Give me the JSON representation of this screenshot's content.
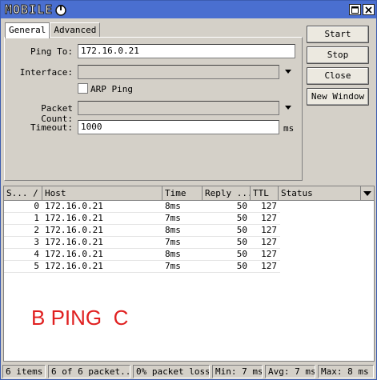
{
  "window": {
    "logo_text": "MOBILE",
    "maximize_icon": "maximize-icon",
    "close_icon": "close-icon"
  },
  "tabs": [
    {
      "label": "General",
      "active": true
    },
    {
      "label": "Advanced",
      "active": false
    }
  ],
  "form": {
    "ping_to_label": "Ping To:",
    "ping_to_value": "172.16.0.21",
    "interface_label": "Interface:",
    "interface_value": "",
    "arp_ping_label": "ARP Ping",
    "arp_ping_checked": false,
    "packet_count_label": "Packet Count:",
    "packet_count_value": "",
    "timeout_label": "Timeout:",
    "timeout_value": "1000",
    "timeout_unit": "ms"
  },
  "buttons": {
    "start": "Start",
    "stop": "Stop",
    "close": "Close",
    "new_window": "New Window"
  },
  "table": {
    "columns": [
      "S... /",
      "Host",
      "Time",
      "Reply ...",
      "TTL",
      "Status"
    ],
    "rows": [
      [
        "0",
        "172.16.0.21",
        "8ms",
        "50",
        "127",
        ""
      ],
      [
        "1",
        "172.16.0.21",
        "7ms",
        "50",
        "127",
        ""
      ],
      [
        "2",
        "172.16.0.21",
        "8ms",
        "50",
        "127",
        ""
      ],
      [
        "3",
        "172.16.0.21",
        "7ms",
        "50",
        "127",
        ""
      ],
      [
        "4",
        "172.16.0.21",
        "8ms",
        "50",
        "127",
        ""
      ],
      [
        "5",
        "172.16.0.21",
        "7ms",
        "50",
        "127",
        ""
      ]
    ]
  },
  "overlay_text": "B PING  C",
  "status": {
    "items": "6 items",
    "packets": "6 of 6 packet...",
    "loss": "0% packet loss",
    "min": "Min: 7 ms",
    "avg": "Avg: 7 ms",
    "max": "Max: 8 ms"
  },
  "colors": {
    "titlebar": "#4a6fd0",
    "overlay": "#e02020"
  }
}
